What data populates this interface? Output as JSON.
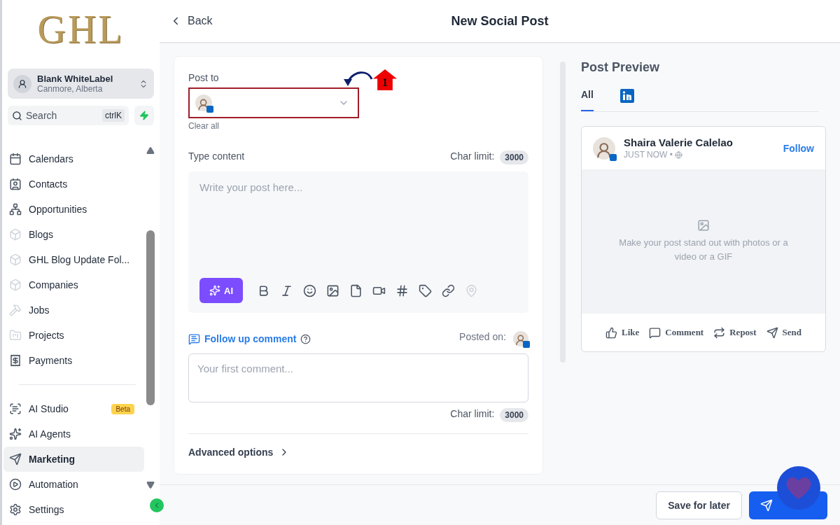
{
  "logo": "GHL",
  "account": {
    "name": "Blank WhiteLabel",
    "location": "Canmore, Alberta"
  },
  "search": {
    "placeholder": "Search",
    "shortcut": "ctrlK"
  },
  "nav_items": [
    {
      "label": "Calendars",
      "selected": false
    },
    {
      "label": "Contacts",
      "selected": false
    },
    {
      "label": "Opportunities",
      "selected": false
    },
    {
      "label": "Blogs",
      "selected": false
    },
    {
      "label": "GHL Blog Update Fol...",
      "selected": false
    },
    {
      "label": "Companies",
      "selected": false
    },
    {
      "label": "Jobs",
      "selected": false
    },
    {
      "label": "Projects",
      "selected": false
    },
    {
      "label": "Payments",
      "selected": false
    }
  ],
  "nav_items_2": [
    {
      "label": "AI Studio",
      "badge": "Beta",
      "selected": false
    },
    {
      "label": "AI Agents",
      "selected": false
    },
    {
      "label": "Marketing",
      "selected": true
    },
    {
      "label": "Automation",
      "selected": false
    },
    {
      "label": "Settings",
      "selected": false
    }
  ],
  "header": {
    "back": "Back",
    "title": "New Social Post"
  },
  "composer": {
    "post_to_label": "Post to",
    "clear_all": "Clear all",
    "annotation": "1",
    "content_label": "Type content",
    "char_limit_label": "Char limit:",
    "char_limit": "3000",
    "content_placeholder": "Write your post here...",
    "ai_button": "AI",
    "follow_up": "Follow up comment",
    "posted_on": "Posted on:",
    "comment_placeholder": "Your first comment...",
    "comment_char_limit_label": "Char limit:",
    "comment_char_limit": "3000",
    "advanced": "Advanced options"
  },
  "preview": {
    "title": "Post Preview",
    "tabs": [
      {
        "kind": "text",
        "label": "All",
        "selected": true
      },
      {
        "kind": "linkedin",
        "selected": false
      }
    ],
    "author": "Shaira Valerie Calelao",
    "time": "JUST NOW •",
    "follow": "Follow",
    "media_hint": "Make your post stand out with photos or a video or a GIF",
    "actions": [
      "Like",
      "Comment",
      "Repost",
      "Send"
    ]
  },
  "footer": {
    "save": "Save for later"
  }
}
